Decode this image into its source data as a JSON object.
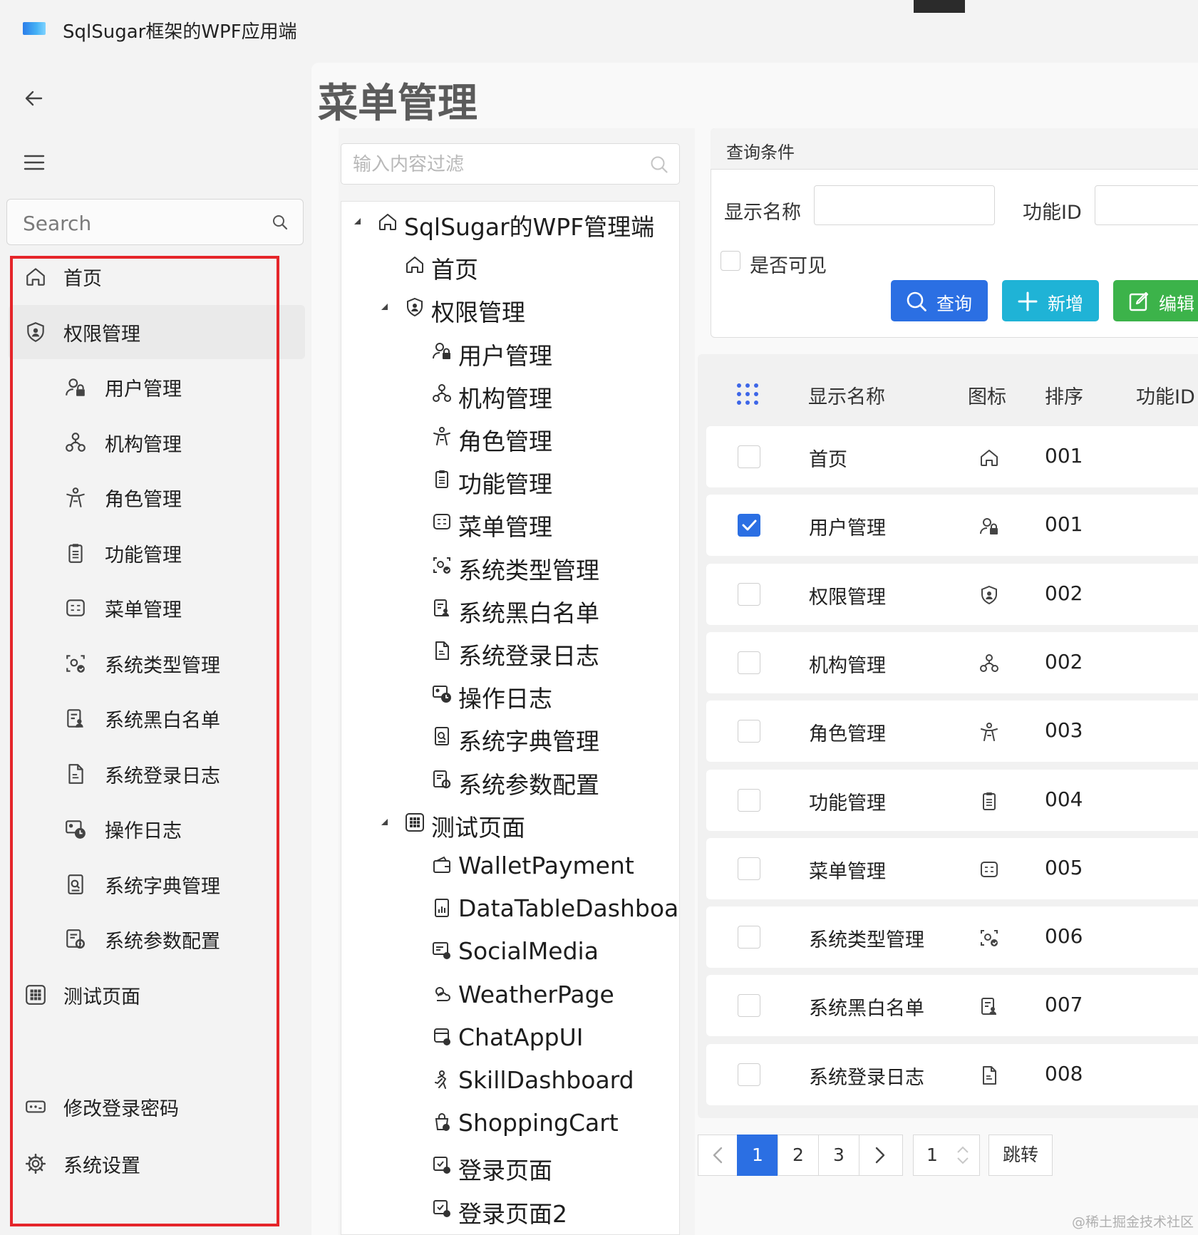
{
  "window": {
    "title": "SqlSugar框架的WPF应用端"
  },
  "nav": {
    "search_placeholder": "Search",
    "items": [
      {
        "label": "首页",
        "icon": "home-icon"
      },
      {
        "label": "权限管理",
        "icon": "shield-icon"
      },
      {
        "label": "用户管理",
        "icon": "user-lock-icon"
      },
      {
        "label": "机构管理",
        "icon": "org-icon"
      },
      {
        "label": "角色管理",
        "icon": "role-icon"
      },
      {
        "label": "功能管理",
        "icon": "clipboard-icon"
      },
      {
        "label": "菜单管理",
        "icon": "menu-icon"
      },
      {
        "label": "系统类型管理",
        "icon": "type-icon"
      },
      {
        "label": "系统黑白名单",
        "icon": "list-icon"
      },
      {
        "label": "系统登录日志",
        "icon": "doc-icon"
      },
      {
        "label": "操作日志",
        "icon": "clock-icon"
      },
      {
        "label": "系统字典管理",
        "icon": "dict-icon"
      },
      {
        "label": "系统参数配置",
        "icon": "config-icon"
      },
      {
        "label": "测试页面",
        "icon": "grid-icon"
      }
    ],
    "footer": [
      {
        "label": "修改登录密码",
        "icon": "password-icon"
      },
      {
        "label": "系统设置",
        "icon": "gear-icon"
      }
    ]
  },
  "page": {
    "title": "菜单管理"
  },
  "tree": {
    "filter_placeholder": "输入内容过滤",
    "nodes": [
      {
        "label": "SqlSugar的WPF管理端",
        "icon": "home-icon"
      },
      {
        "label": "首页",
        "icon": "home-icon"
      },
      {
        "label": "权限管理",
        "icon": "shield-icon"
      },
      {
        "label": "用户管理",
        "icon": "user-lock-icon"
      },
      {
        "label": "机构管理",
        "icon": "org-icon"
      },
      {
        "label": "角色管理",
        "icon": "role-icon"
      },
      {
        "label": "功能管理",
        "icon": "clipboard-icon"
      },
      {
        "label": "菜单管理",
        "icon": "menu-icon"
      },
      {
        "label": "系统类型管理",
        "icon": "type-icon"
      },
      {
        "label": "系统黑白名单",
        "icon": "list-icon"
      },
      {
        "label": "系统登录日志",
        "icon": "doc-icon"
      },
      {
        "label": "操作日志",
        "icon": "clock-icon"
      },
      {
        "label": "系统字典管理",
        "icon": "dict-icon"
      },
      {
        "label": "系统参数配置",
        "icon": "config-icon"
      },
      {
        "label": "测试页面",
        "icon": "grid-icon"
      },
      {
        "label": "WalletPayment",
        "icon": "wallet-icon"
      },
      {
        "label": "DataTableDashboa",
        "icon": "chart-icon"
      },
      {
        "label": "SocialMedia",
        "icon": "social-icon"
      },
      {
        "label": "WeatherPage",
        "icon": "weather-icon"
      },
      {
        "label": "ChatAppUI",
        "icon": "chat-icon"
      },
      {
        "label": "SkillDashboard",
        "icon": "skill-icon"
      },
      {
        "label": "ShoppingCart",
        "icon": "cart-icon"
      },
      {
        "label": "登录页面",
        "icon": "login-icon"
      },
      {
        "label": "登录页面2",
        "icon": "login-icon"
      }
    ]
  },
  "query": {
    "header": "查询条件",
    "display_name_label": "显示名称",
    "function_id_label": "功能ID",
    "visible_label": "是否可见",
    "search_button": "查询",
    "add_button": "新增",
    "edit_button": "编辑"
  },
  "table": {
    "columns": [
      "显示名称",
      "图标",
      "排序",
      "功能ID"
    ],
    "rows": [
      {
        "name": "首页",
        "icon": "home-icon",
        "order": "001",
        "checked": false
      },
      {
        "name": "用户管理",
        "icon": "user-lock-icon",
        "order": "001",
        "checked": true
      },
      {
        "name": "权限管理",
        "icon": "shield-icon",
        "order": "002",
        "checked": false
      },
      {
        "name": "机构管理",
        "icon": "org-icon",
        "order": "002",
        "checked": false
      },
      {
        "name": "角色管理",
        "icon": "role-icon",
        "order": "003",
        "checked": false
      },
      {
        "name": "功能管理",
        "icon": "clipboard-icon",
        "order": "004",
        "checked": false
      },
      {
        "name": "菜单管理",
        "icon": "menu-icon",
        "order": "005",
        "checked": false
      },
      {
        "name": "系统类型管理",
        "icon": "type-icon",
        "order": "006",
        "checked": false
      },
      {
        "name": "系统黑白名单",
        "icon": "list-icon",
        "order": "007",
        "checked": false
      },
      {
        "name": "系统登录日志",
        "icon": "doc-icon",
        "order": "008",
        "checked": false
      }
    ]
  },
  "pagination": {
    "pages": [
      "1",
      "2",
      "3"
    ],
    "current": "1",
    "page_input": "1",
    "jump_label": "跳转"
  },
  "watermark": "@稀土掘金技术社区",
  "colors": {
    "primary": "#2b6fe3",
    "info": "#1fb3d6",
    "success": "#3cb34a",
    "highlight": "#e5252a"
  }
}
